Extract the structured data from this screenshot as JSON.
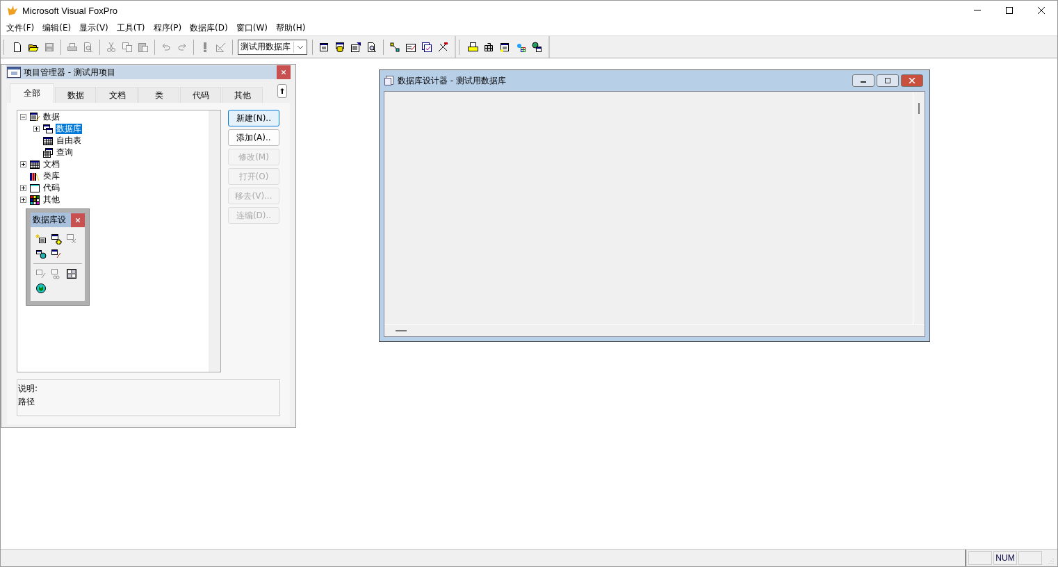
{
  "window": {
    "title": "Microsoft Visual FoxPro"
  },
  "menu": [
    "文件(F)",
    "编辑(E)",
    "显示(V)",
    "工具(T)",
    "程序(P)",
    "数据库(D)",
    "窗口(W)",
    "帮助(H)"
  ],
  "toolbars": [
    {
      "groups": [
        [
          {
            "kind": "new",
            "disabled": false
          },
          {
            "kind": "open",
            "disabled": false
          },
          {
            "kind": "save",
            "disabled": true
          }
        ],
        [
          {
            "kind": "print",
            "disabled": true
          },
          {
            "kind": "preview",
            "disabled": true
          }
        ],
        [
          {
            "kind": "cut",
            "disabled": true
          },
          {
            "kind": "copy",
            "disabled": true
          },
          {
            "kind": "paste",
            "disabled": true
          }
        ],
        [
          {
            "kind": "undo",
            "disabled": true
          },
          {
            "kind": "redo",
            "disabled": true
          }
        ],
        [
          {
            "kind": "run",
            "disabled": true
          },
          {
            "kind": "modify",
            "disabled": true
          }
        ],
        [
          {
            "kind": "combo",
            "value": "测试用数据库"
          }
        ],
        [
          {
            "kind": "form",
            "disabled": false
          },
          {
            "kind": "database",
            "disabled": false
          },
          {
            "kind": "properties",
            "disabled": false
          },
          {
            "kind": "browse",
            "disabled": false
          }
        ],
        [
          {
            "kind": "connect",
            "disabled": false
          },
          {
            "kind": "editform",
            "disabled": false
          },
          {
            "kind": "checkform",
            "disabled": false
          },
          {
            "kind": "tools",
            "disabled": false
          }
        ]
      ]
    },
    {
      "groups": [
        [
          {
            "kind": "printer",
            "disabled": false
          },
          {
            "kind": "grid",
            "disabled": false
          },
          {
            "kind": "wizard",
            "disabled": false
          },
          {
            "kind": "network",
            "disabled": false
          },
          {
            "kind": "dbglobe",
            "disabled": false
          }
        ]
      ]
    }
  ],
  "project_manager": {
    "title": "项目管理器 - 测试用项目",
    "tabs": [
      {
        "label": "全部",
        "selected": true
      },
      {
        "label": "数据",
        "selected": false
      },
      {
        "label": "文档",
        "selected": false
      },
      {
        "label": "类",
        "selected": false
      },
      {
        "label": "代码",
        "selected": false
      },
      {
        "label": "其他",
        "selected": false
      }
    ],
    "tree": [
      {
        "label": "数据",
        "kind": "data",
        "expanded": true,
        "selected": false,
        "children": [
          {
            "label": "数据库",
            "kind": "database",
            "expanded": false,
            "selected": true
          },
          {
            "label": "自由表",
            "kind": "table",
            "selected": false
          },
          {
            "label": "查询",
            "kind": "query",
            "selected": false
          }
        ]
      },
      {
        "label": "文档",
        "kind": "docs",
        "expanded": false,
        "selected": false
      },
      {
        "label": "类库",
        "kind": "classlib",
        "selected": false
      },
      {
        "label": "代码",
        "kind": "code",
        "expanded": false,
        "selected": false
      },
      {
        "label": "其他",
        "kind": "other",
        "expanded": false,
        "selected": false
      }
    ],
    "buttons": [
      {
        "label": "新建(N)..",
        "disabled": false,
        "default": true
      },
      {
        "label": "添加(A)..",
        "disabled": false,
        "default": false
      },
      {
        "label": "修改(M)",
        "disabled": true,
        "default": false
      },
      {
        "label": "打开(O)",
        "disabled": true,
        "default": false
      },
      {
        "label": "移去(V)...",
        "disabled": true,
        "default": false
      },
      {
        "label": "连编(D)..",
        "disabled": true,
        "default": false
      }
    ],
    "description_label": "说明:",
    "path_label": "路径"
  },
  "designer_toolbar": {
    "title": "数据库设",
    "rows": [
      [
        {
          "kind": "newtable",
          "disabled": false
        },
        {
          "kind": "addtable",
          "disabled": false
        },
        {
          "kind": "removetable",
          "disabled": true
        },
        {
          "kind": "remoteview",
          "disabled": false
        },
        {
          "kind": "localview",
          "disabled": false
        }
      ],
      [
        {
          "kind": "editproc",
          "disabled": true
        },
        {
          "kind": "connections",
          "disabled": true
        },
        {
          "kind": "binary",
          "disabled": false
        },
        {
          "kind": "globe",
          "disabled": false
        }
      ]
    ]
  },
  "designer": {
    "title": "数据库设计器 - 测试用数据库"
  },
  "status_bar": {
    "indicator": "NUM"
  }
}
